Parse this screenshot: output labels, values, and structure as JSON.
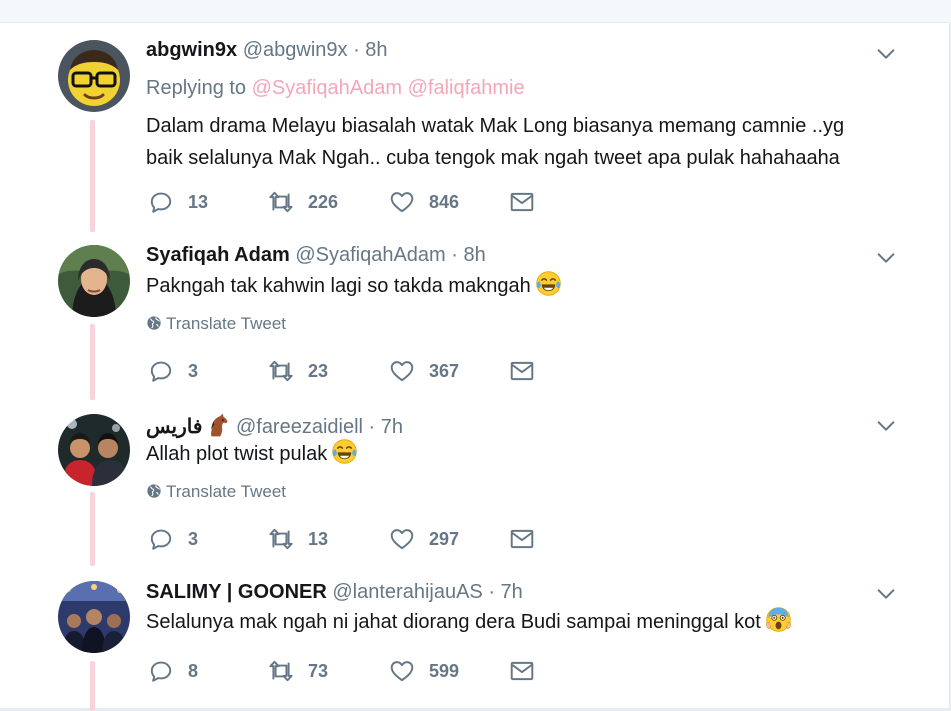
{
  "tweets": [
    {
      "display_name": "abgwin9x",
      "handle": "@abgwin9x",
      "time": "· 8h",
      "replying_prefix": "Replying to",
      "replying_to": [
        "@SyafiqahAdam",
        "@faliqfahmie"
      ],
      "text_lines": [
        "Dalam drama Melayu biasalah watak Mak Long biasanya memang camnie ..yg",
        "baik selalunya Mak Ngah.. cuba tengok mak ngah tweet apa pulak hahahaaha"
      ],
      "replies": "13",
      "retweets": "226",
      "likes": "846",
      "avatar_icon": "memoji-glasses-avatar"
    },
    {
      "display_name": "Syafiqah Adam",
      "handle": "@SyafiqahAdam",
      "time": "· 8h",
      "text": "Pakngah tak kahwin lagi so takda makngah",
      "emoji": "face-with-tears-of-joy",
      "translate": "Translate Tweet",
      "replies": "3",
      "retweets": "23",
      "likes": "367",
      "avatar_icon": "woman-hijab-photo-avatar"
    },
    {
      "display_name": "فاريس",
      "display_emoji": "horse-face",
      "handle": "@fareezaidiell",
      "time": "· 7h",
      "text": "Allah plot twist pulak",
      "emoji": "face-with-tears-of-joy",
      "translate": "Translate Tweet",
      "replies": "3",
      "retweets": "13",
      "likes": "297",
      "avatar_icon": "two-men-photo-avatar"
    },
    {
      "display_name": "SALIMY | GOONER",
      "handle": "@lanterahijauAS",
      "time": "· 7h",
      "text": "Selalunya mak ngah ni jahat diorang dera Budi sampai meninggal kot",
      "emoji": "face-screaming-in-fear",
      "replies": "8",
      "retweets": "73",
      "likes": "599",
      "avatar_icon": "group-photo-avatar"
    }
  ],
  "colors": {
    "thread_line": "#f8d3dc",
    "mention": "#f4a6b8",
    "meta_gray": "#657786",
    "text": "#14171a"
  }
}
